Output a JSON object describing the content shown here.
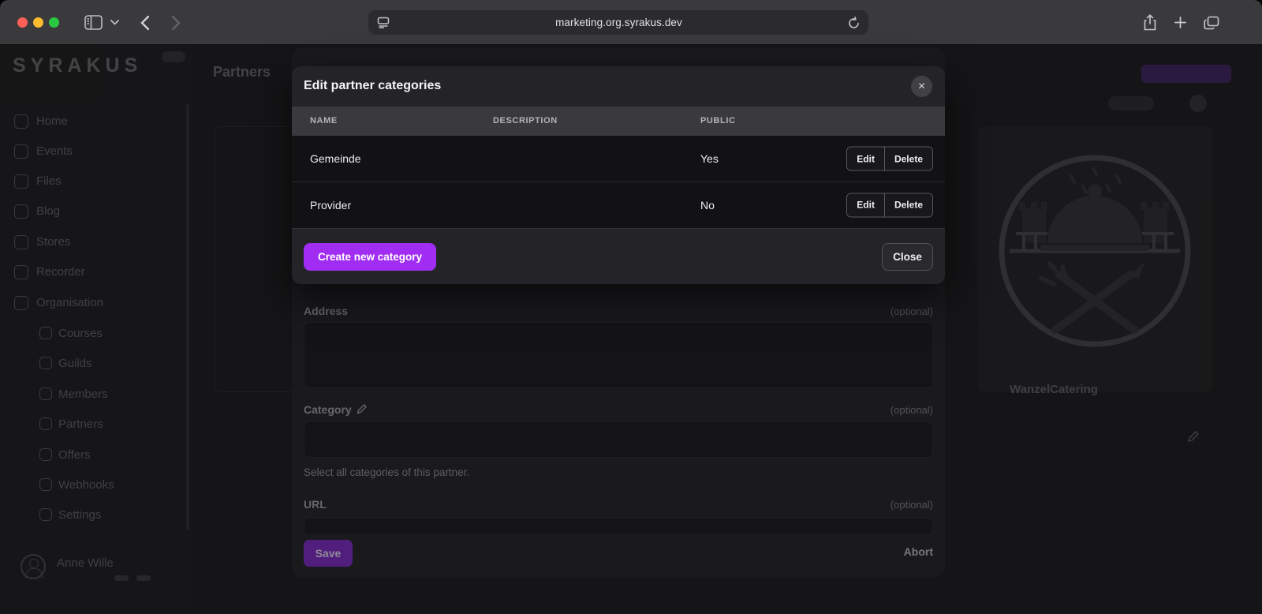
{
  "browser": {
    "url": "marketing.org.syrakus.dev"
  },
  "modal": {
    "title": "Edit partner categories",
    "close_x": "×",
    "table": {
      "headers": [
        "NAME",
        "DESCRIPTION",
        "PUBLIC"
      ],
      "rows": [
        {
          "name": "Gemeinde",
          "description": "",
          "public": "Yes",
          "edit": "Edit",
          "delete": "Delete"
        },
        {
          "name": "Provider",
          "description": "",
          "public": "No",
          "edit": "Edit",
          "delete": "Delete"
        }
      ]
    },
    "create_button": "Create new category",
    "close_button": "Close"
  },
  "partner_form": {
    "address_label": "Address",
    "address_optional": "(optional)",
    "category_label": "Category",
    "category_optional": "(optional)",
    "category_help": "Select all categories of this partner.",
    "url_label": "URL",
    "url_optional": "(optional)",
    "save_button": "Save",
    "abort_button": "Abort"
  },
  "page": {
    "title": "Partners",
    "sidebar": {
      "logo": "SYRAKUS",
      "items": [
        {
          "label": "Home"
        },
        {
          "label": "Events"
        },
        {
          "label": "Files"
        },
        {
          "label": "Blog"
        },
        {
          "label": "Stores"
        },
        {
          "label": "Recorder"
        },
        {
          "label": "Organisation"
        }
      ],
      "subitems": [
        {
          "label": "Courses"
        },
        {
          "label": "Guilds"
        },
        {
          "label": "Members"
        },
        {
          "label": "Partners"
        },
        {
          "label": "Offers"
        },
        {
          "label": "Webhooks"
        },
        {
          "label": "Settings"
        }
      ],
      "user_name": "Anne Wille"
    },
    "partner_card": {
      "name": "WanzelCatering"
    }
  },
  "colors": {
    "accent_purple": "#a12df2",
    "save_purple": "#7e22ce",
    "traffic_red": "#ff5f57",
    "traffic_yellow": "#febc2e",
    "traffic_green": "#28c840"
  }
}
